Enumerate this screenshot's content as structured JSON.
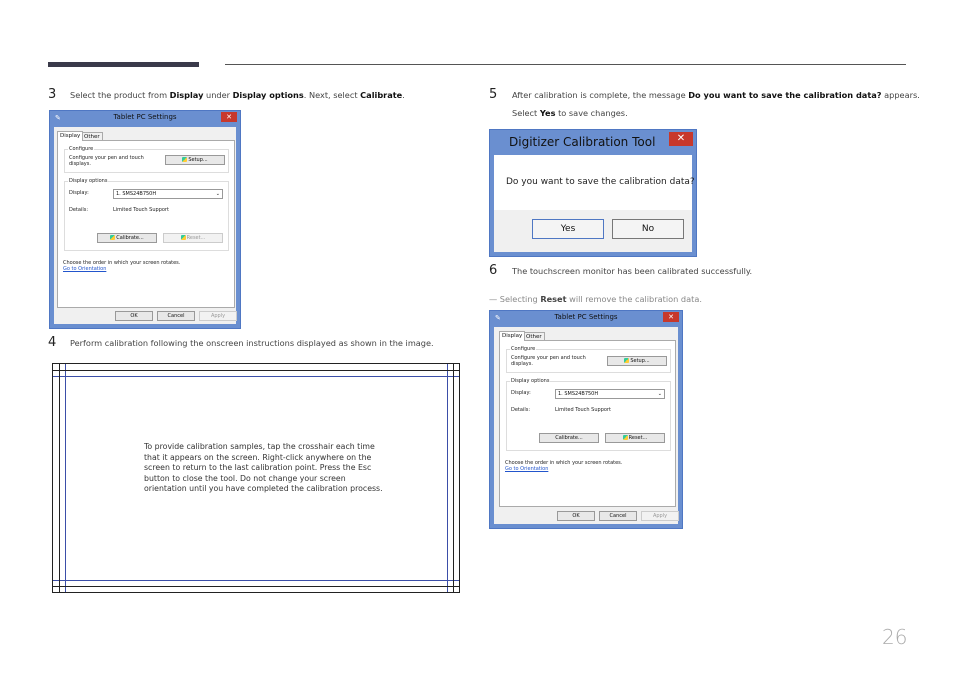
{
  "page_number": "26",
  "steps": {
    "s3": {
      "num": "3",
      "t1": "Select the product from ",
      "b1": "Display",
      "t2": " under ",
      "b2": "Display options",
      "t3": ". Next, select ",
      "b3": "Calibrate",
      "t4": "."
    },
    "s4": {
      "num": "4",
      "text": "Perform calibration following the onscreen instructions displayed as shown in the image."
    },
    "s5": {
      "num": "5",
      "t1": "After calibration is complete, the message ",
      "b1": "Do you want to save the calibration data?",
      "t2": " appears.",
      "t3": "Select ",
      "b2": "Yes",
      "t4": " to save changes."
    },
    "s6": {
      "num": "6",
      "text": "The touchscreen monitor has been calibrated successfully."
    },
    "note": {
      "dash": "—",
      "t1": " Selecting ",
      "b1": "Reset",
      "t2": " will remove the calibration data."
    }
  },
  "tablet_window": {
    "title": "Tablet PC Settings",
    "close": "✕",
    "tabs": [
      "Display",
      "Other"
    ],
    "configure_group": "Configure",
    "configure_text_1": "Configure your pen and touch",
    "configure_text_2": "displays.",
    "setup_button": "Setup...",
    "display_options_group": "Display options",
    "display_label": "Display:",
    "display_value": "1. SMS24B750H",
    "details_label": "Details:",
    "details_value": "Limited Touch Support",
    "calibrate_button": "Calibrate...",
    "reset_button": "Reset...",
    "orientation_text": "Choose the order in which your screen rotates.",
    "orientation_link": "Go to Orientation",
    "ok_button": "OK",
    "cancel_button": "Cancel",
    "apply_button": "Apply"
  },
  "digitizer_dialog": {
    "title": "Digitizer Calibration Tool",
    "close": "✕",
    "message": "Do you want to save the calibration data?",
    "yes_button": "Yes",
    "no_button": "No"
  },
  "calibration_screen": {
    "text": "To provide calibration samples, tap the crosshair each time that it appears on the screen. Right-click anywhere on the screen to return to the last calibration point. Press the Esc button to close the tool. Do not change your screen orientation until you have completed the calibration process."
  }
}
